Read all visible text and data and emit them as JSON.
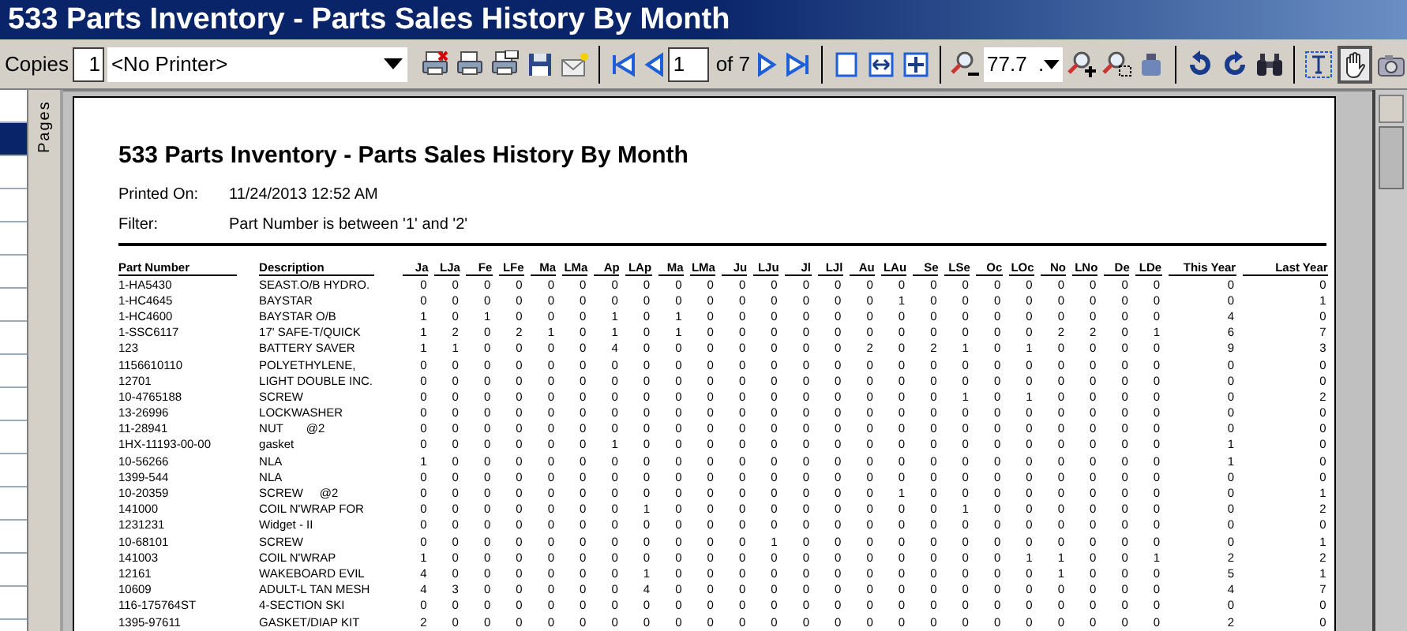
{
  "window": {
    "title": "533 Parts Inventory - Parts Sales History By Month"
  },
  "toolbar": {
    "copies_label": "Copies",
    "copies": "1",
    "printer": "<No Printer>",
    "page": "1",
    "page_count": "of 7",
    "zoom": "77.7  .",
    "hand_tool": {
      "selected": true
    }
  },
  "sidebar": {
    "label": "Pages"
  },
  "report": {
    "title": "533 Parts Inventory - Parts Sales History By Month",
    "meta": [
      {
        "label": "Printed On:",
        "value": "11/24/2013 12:52 AM"
      },
      {
        "label": "Filter:",
        "value": "Part Number is between '1' and '2'"
      }
    ],
    "columns": [
      "Part Number",
      "Description",
      "Ja",
      "LJa",
      "Fe",
      "LFe",
      "Ma",
      "LMa",
      "Ap",
      "LAp",
      "Ma",
      "LMa",
      "Ju",
      "LJu",
      "Jl",
      "LJl",
      "Au",
      "LAu",
      "Se",
      "LSe",
      "Oc",
      "LOc",
      "No",
      "LNo",
      "De",
      "LDe",
      "This Year",
      "Last Year"
    ],
    "rows": [
      [
        "1-HA5430",
        "SEAST.O/B HYDRO.",
        "0",
        "0",
        "0",
        "0",
        "0",
        "0",
        "0",
        "0",
        "0",
        "0",
        "0",
        "0",
        "0",
        "0",
        "0",
        "0",
        "0",
        "0",
        "0",
        "0",
        "0",
        "0",
        "0",
        "0",
        "0",
        "0"
      ],
      [
        "1-HC4645",
        "BAYSTAR",
        "0",
        "0",
        "0",
        "0",
        "0",
        "0",
        "0",
        "0",
        "0",
        "0",
        "0",
        "0",
        "0",
        "0",
        "0",
        "1",
        "0",
        "0",
        "0",
        "0",
        "0",
        "0",
        "0",
        "0",
        "0",
        "1"
      ],
      [
        "1-HC4600",
        "BAYSTAR O/B",
        "1",
        "0",
        "1",
        "0",
        "0",
        "0",
        "1",
        "0",
        "1",
        "0",
        "0",
        "0",
        "0",
        "0",
        "0",
        "0",
        "0",
        "0",
        "0",
        "0",
        "0",
        "0",
        "0",
        "0",
        "4",
        "0"
      ],
      [
        "1-SSC6117",
        "17' SAFE-T/QUICK",
        "1",
        "2",
        "0",
        "2",
        "1",
        "0",
        "1",
        "0",
        "1",
        "0",
        "0",
        "0",
        "0",
        "0",
        "0",
        "0",
        "0",
        "0",
        "0",
        "0",
        "2",
        "2",
        "0",
        "1",
        "6",
        "7"
      ],
      [
        "123",
        "BATTERY SAVER",
        "1",
        "1",
        "0",
        "0",
        "0",
        "0",
        "4",
        "0",
        "0",
        "0",
        "0",
        "0",
        "0",
        "0",
        "2",
        "0",
        "2",
        "1",
        "0",
        "1",
        "0",
        "0",
        "0",
        "0",
        "9",
        "3"
      ],
      [
        "1156610110",
        "POLYETHYLENE,",
        "0",
        "0",
        "0",
        "0",
        "0",
        "0",
        "0",
        "0",
        "0",
        "0",
        "0",
        "0",
        "0",
        "0",
        "0",
        "0",
        "0",
        "0",
        "0",
        "0",
        "0",
        "0",
        "0",
        "0",
        "0",
        "0"
      ],
      [
        "12701",
        "LIGHT DOUBLE INC.",
        "0",
        "0",
        "0",
        "0",
        "0",
        "0",
        "0",
        "0",
        "0",
        "0",
        "0",
        "0",
        "0",
        "0",
        "0",
        "0",
        "0",
        "0",
        "0",
        "0",
        "0",
        "0",
        "0",
        "0",
        "0",
        "0"
      ],
      [
        "10-4765188",
        "SCREW",
        "0",
        "0",
        "0",
        "0",
        "0",
        "0",
        "0",
        "0",
        "0",
        "0",
        "0",
        "0",
        "0",
        "0",
        "0",
        "0",
        "0",
        "1",
        "0",
        "1",
        "0",
        "0",
        "0",
        "0",
        "0",
        "2"
      ],
      [
        "13-26996",
        "LOCKWASHER",
        "0",
        "0",
        "0",
        "0",
        "0",
        "0",
        "0",
        "0",
        "0",
        "0",
        "0",
        "0",
        "0",
        "0",
        "0",
        "0",
        "0",
        "0",
        "0",
        "0",
        "0",
        "0",
        "0",
        "0",
        "0",
        "0"
      ],
      [
        "11-28941",
        "NUT       @2",
        "0",
        "0",
        "0",
        "0",
        "0",
        "0",
        "0",
        "0",
        "0",
        "0",
        "0",
        "0",
        "0",
        "0",
        "0",
        "0",
        "0",
        "0",
        "0",
        "0",
        "0",
        "0",
        "0",
        "0",
        "0",
        "0"
      ],
      [
        "1HX-11193-00-00",
        "gasket",
        "0",
        "0",
        "0",
        "0",
        "0",
        "0",
        "1",
        "0",
        "0",
        "0",
        "0",
        "0",
        "0",
        "0",
        "0",
        "0",
        "0",
        "0",
        "0",
        "0",
        "0",
        "0",
        "0",
        "0",
        "1",
        "0"
      ],
      [
        "10-56266",
        "NLA",
        "1",
        "0",
        "0",
        "0",
        "0",
        "0",
        "0",
        "0",
        "0",
        "0",
        "0",
        "0",
        "0",
        "0",
        "0",
        "0",
        "0",
        "0",
        "0",
        "0",
        "0",
        "0",
        "0",
        "0",
        "1",
        "0"
      ],
      [
        "1399-544",
        "NLA",
        "0",
        "0",
        "0",
        "0",
        "0",
        "0",
        "0",
        "0",
        "0",
        "0",
        "0",
        "0",
        "0",
        "0",
        "0",
        "0",
        "0",
        "0",
        "0",
        "0",
        "0",
        "0",
        "0",
        "0",
        "0",
        "0"
      ],
      [
        "10-20359",
        "SCREW     @2",
        "0",
        "0",
        "0",
        "0",
        "0",
        "0",
        "0",
        "0",
        "0",
        "0",
        "0",
        "0",
        "0",
        "0",
        "0",
        "1",
        "0",
        "0",
        "0",
        "0",
        "0",
        "0",
        "0",
        "0",
        "0",
        "1"
      ],
      [
        "141000",
        "COIL N'WRAP FOR",
        "0",
        "0",
        "0",
        "0",
        "0",
        "0",
        "0",
        "1",
        "0",
        "0",
        "0",
        "0",
        "0",
        "0",
        "0",
        "0",
        "0",
        "1",
        "0",
        "0",
        "0",
        "0",
        "0",
        "0",
        "0",
        "2"
      ],
      [
        "1231231",
        "Widget - II",
        "0",
        "0",
        "0",
        "0",
        "0",
        "0",
        "0",
        "0",
        "0",
        "0",
        "0",
        "0",
        "0",
        "0",
        "0",
        "0",
        "0",
        "0",
        "0",
        "0",
        "0",
        "0",
        "0",
        "0",
        "0",
        "0"
      ],
      [
        "10-68101",
        "SCREW",
        "0",
        "0",
        "0",
        "0",
        "0",
        "0",
        "0",
        "0",
        "0",
        "0",
        "0",
        "1",
        "0",
        "0",
        "0",
        "0",
        "0",
        "0",
        "0",
        "0",
        "0",
        "0",
        "0",
        "0",
        "0",
        "1"
      ],
      [
        "141003",
        "COIL N'WRAP",
        "1",
        "0",
        "0",
        "0",
        "0",
        "0",
        "0",
        "0",
        "0",
        "0",
        "0",
        "0",
        "0",
        "0",
        "0",
        "0",
        "0",
        "0",
        "0",
        "1",
        "1",
        "0",
        "0",
        "1",
        "2",
        "2"
      ],
      [
        "12161",
        "WAKEBOARD EVIL",
        "4",
        "0",
        "0",
        "0",
        "0",
        "0",
        "0",
        "1",
        "0",
        "0",
        "0",
        "0",
        "0",
        "0",
        "0",
        "0",
        "0",
        "0",
        "0",
        "0",
        "1",
        "0",
        "0",
        "0",
        "5",
        "1"
      ],
      [
        "10609",
        "ADULT-L TAN MESH",
        "4",
        "3",
        "0",
        "0",
        "0",
        "0",
        "0",
        "4",
        "0",
        "0",
        "0",
        "0",
        "0",
        "0",
        "0",
        "0",
        "0",
        "0",
        "0",
        "0",
        "0",
        "0",
        "0",
        "0",
        "4",
        "7"
      ],
      [
        "116-175764ST",
        "4-SECTION SKI",
        "0",
        "0",
        "0",
        "0",
        "0",
        "0",
        "0",
        "0",
        "0",
        "0",
        "0",
        "0",
        "0",
        "0",
        "0",
        "0",
        "0",
        "0",
        "0",
        "0",
        "0",
        "0",
        "0",
        "0",
        "0",
        "0"
      ],
      [
        "1395-97611",
        "GASKET/DIAP KIT",
        "2",
        "0",
        "0",
        "0",
        "0",
        "0",
        "0",
        "0",
        "0",
        "0",
        "0",
        "0",
        "0",
        "0",
        "0",
        "0",
        "0",
        "0",
        "0",
        "0",
        "0",
        "0",
        "0",
        "0",
        "2",
        "0"
      ]
    ]
  }
}
